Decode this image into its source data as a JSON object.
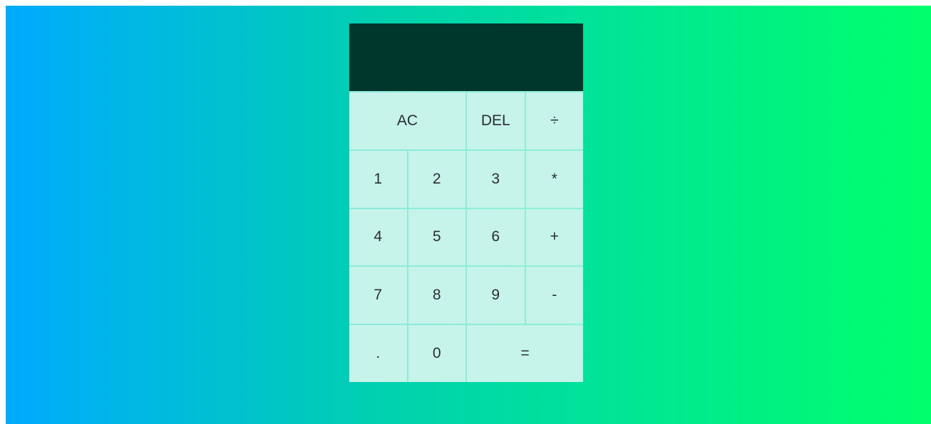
{
  "display": {
    "previous_operand": "",
    "current_operand": ""
  },
  "keys": {
    "all_clear": "AC",
    "delete": "DEL",
    "divide": "÷",
    "one": "1",
    "two": "2",
    "three": "3",
    "multiply": "*",
    "four": "4",
    "five": "5",
    "six": "6",
    "add": "+",
    "seven": "7",
    "eight": "8",
    "nine": "9",
    "subtract": "-",
    "decimal": ".",
    "zero": "0",
    "equals": "="
  },
  "colors": {
    "background_gradient_start": "#00aaff",
    "background_gradient_end": "#00ff6c",
    "display_background": "#00372d",
    "key_background": "#c6f3ea"
  }
}
